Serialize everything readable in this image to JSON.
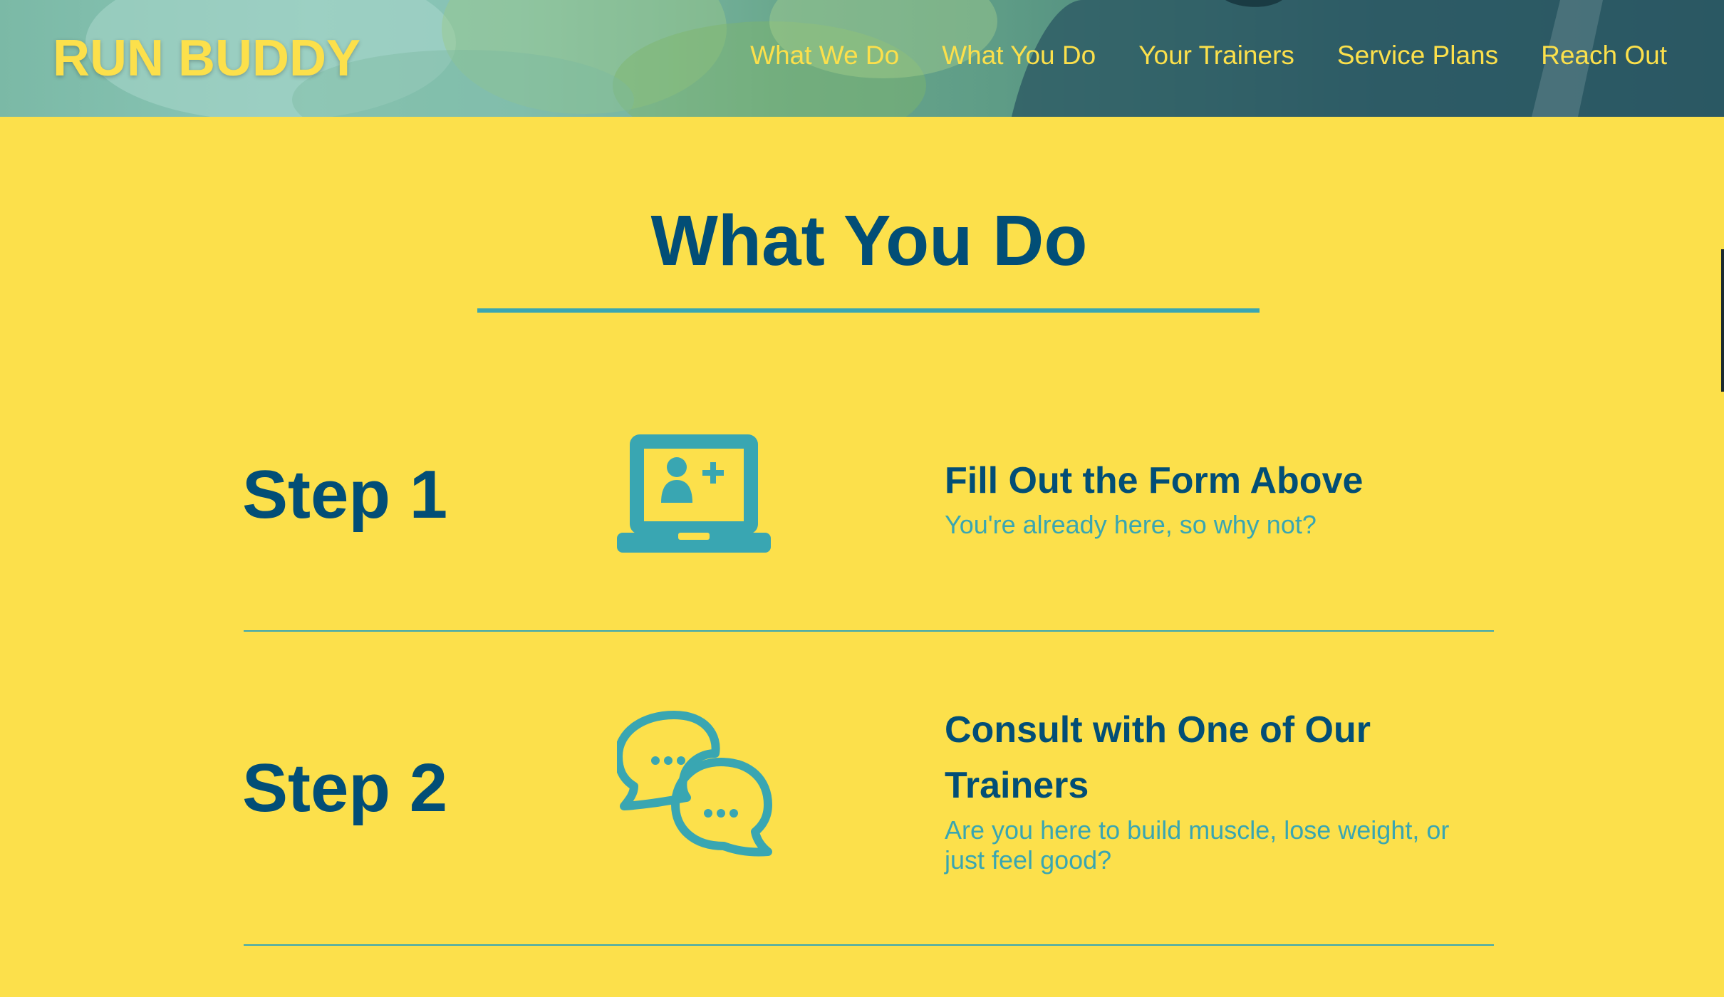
{
  "header": {
    "logo": "RUN BUDDY",
    "nav": [
      "What We Do",
      "What You Do",
      "Your Trainers",
      "Service Plans",
      "Reach Out"
    ]
  },
  "section": {
    "title": "What You Do",
    "steps": [
      {
        "label": "Step 1",
        "icon": "laptop-add-user-icon",
        "heading": "Fill Out the Form Above",
        "description": "You're already here, so why not?"
      },
      {
        "label": "Step 2",
        "icon": "chat-bubbles-icon",
        "heading": "Consult with One of Our Trainers",
        "description": "Are you here to build muscle, lose weight, or just feel good?"
      }
    ]
  },
  "colors": {
    "background": "#fce04b",
    "primary": "#024e76",
    "accent": "#39a6b2"
  }
}
